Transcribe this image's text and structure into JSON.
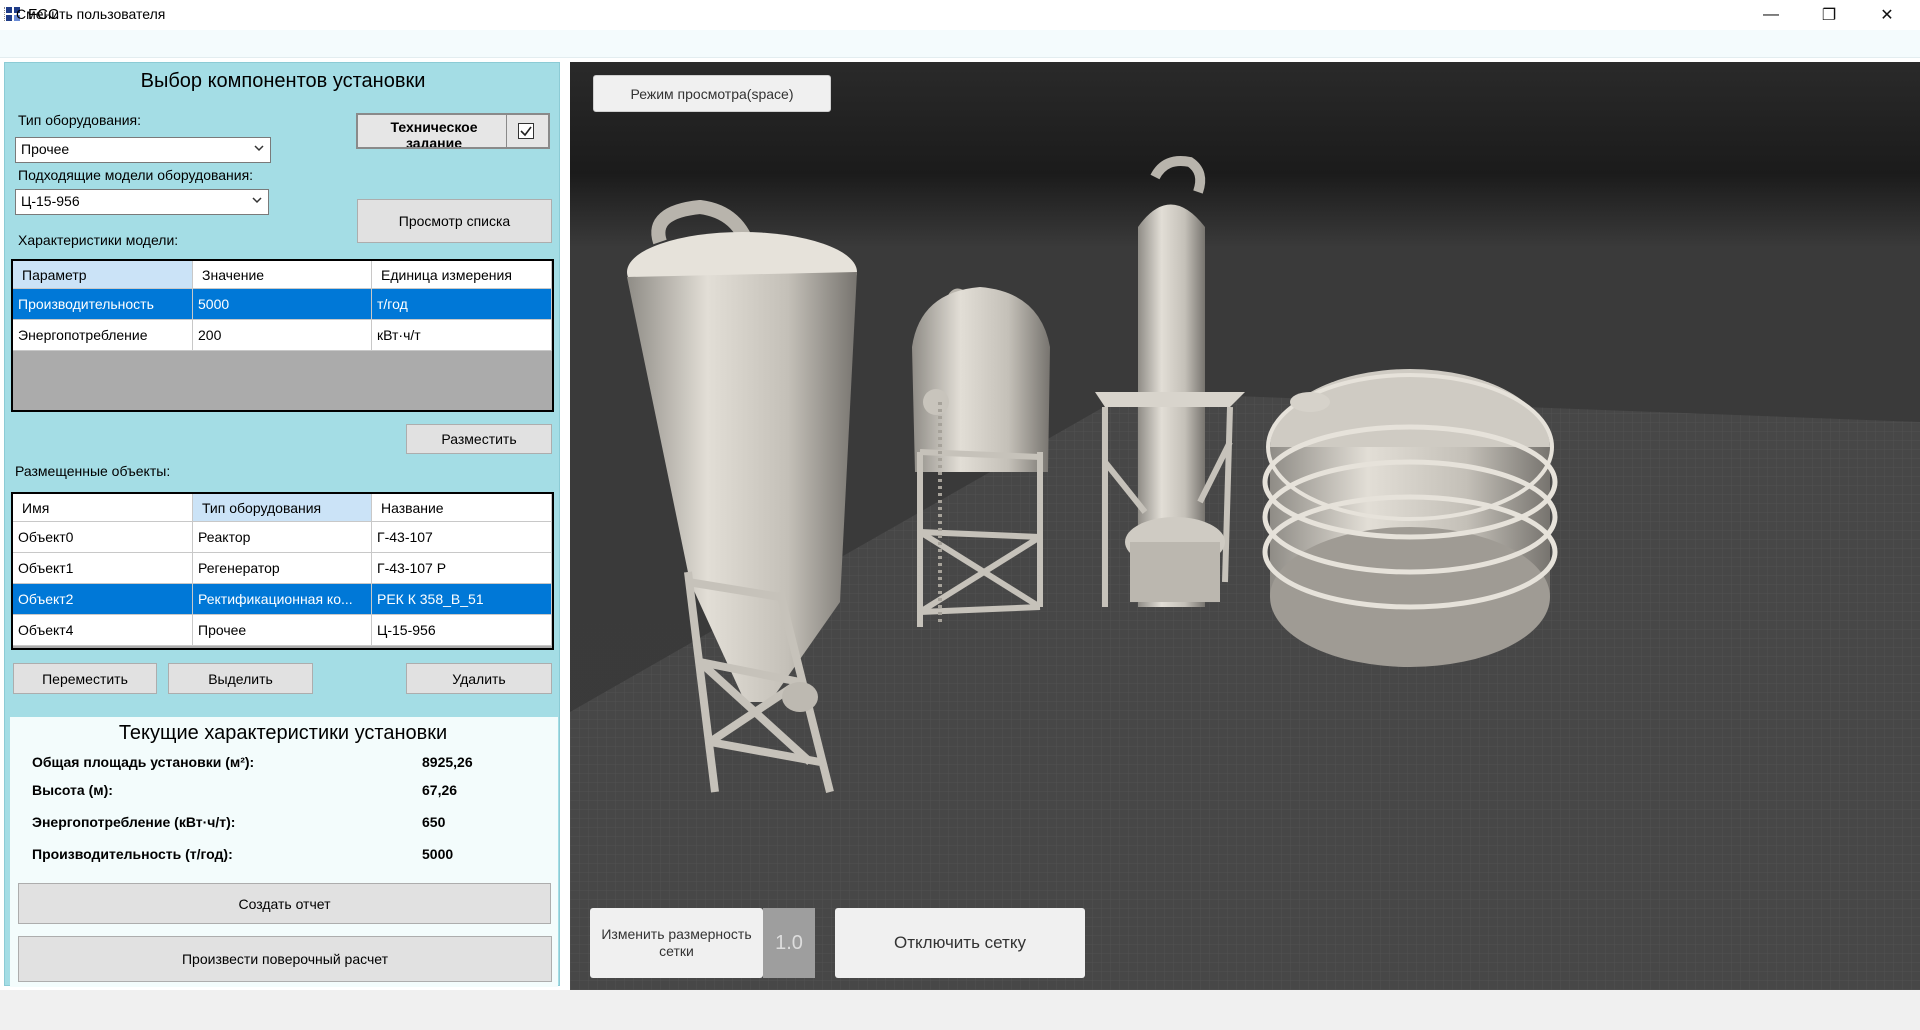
{
  "window": {
    "title": "FCC",
    "minimize_glyph": "—",
    "restore_glyph": "❐",
    "close_glyph": "✕"
  },
  "menu": {
    "change_user": "Сменить пользователя"
  },
  "selection": {
    "title": "Выбор компонентов установки",
    "equipment_type_label": "Тип оборудования:",
    "equipment_type_value": "Прочее",
    "models_label": "Подходящие модели оборудования:",
    "model_value": "Ц-15-956",
    "tech_task_label": "Техническое задание",
    "tech_task_checked": true,
    "view_list_button": "Просмотр списка",
    "characteristics_label": "Характеристики модели:",
    "place_button": "Разместить"
  },
  "characteristics_table": {
    "columns": [
      "Параметр",
      "Значение",
      "Единица измерения"
    ],
    "rows": [
      {
        "param": "Производительность",
        "value": "5000",
        "unit": "т/год",
        "selected": true
      },
      {
        "param": "Энергопотребление",
        "value": "200",
        "unit": "кВт·ч/т",
        "selected": false
      }
    ]
  },
  "placed": {
    "label": "Размещенные объекты:",
    "columns": [
      "Имя",
      "Тип оборудования",
      "Название"
    ],
    "rows": [
      {
        "name": "Объект0",
        "type": "Реактор",
        "title": "Г-43-107",
        "selected": false
      },
      {
        "name": "Объект1",
        "type": "Регенератор",
        "title": "Г-43-107 Р",
        "selected": false
      },
      {
        "name": "Объект2",
        "type": "Ректификационная ко...",
        "title": "РЕК К 358_В_51",
        "selected": true
      },
      {
        "name": "Объект4",
        "type": "Прочее",
        "title": "Ц-15-956",
        "selected": false
      }
    ],
    "move_button": "Переместить",
    "select_button": "Выделить",
    "delete_button": "Удалить"
  },
  "summary": {
    "title": "Текущие характеристики установки",
    "area_label": "Общая площадь установки (м²):",
    "area_value": "8925,26",
    "height_label": "Высота (м):",
    "height_value": "67,26",
    "energy_label": "Энергопотребление (кВт·ч/т):",
    "energy_value": "650",
    "productivity_label": "Производительность (т/год):",
    "productivity_value": "5000",
    "report_button": "Создать отчет",
    "verify_button": "Произвести поверочный расчет"
  },
  "viewport": {
    "view_mode_button": "Режим просмотра(space)",
    "grid_size_button": "Изменить размерность сетки",
    "grid_size_value": "1.0",
    "grid_toggle_button": "Отключить сетку",
    "background_color": "#383838",
    "floor_color": "#4a4a4a",
    "equipment_color": "#d6d2ca"
  },
  "colors": {
    "panel_bg": "#a4dde5",
    "selection_blue": "#0078d7",
    "header_highlight": "#cbe3f7"
  }
}
